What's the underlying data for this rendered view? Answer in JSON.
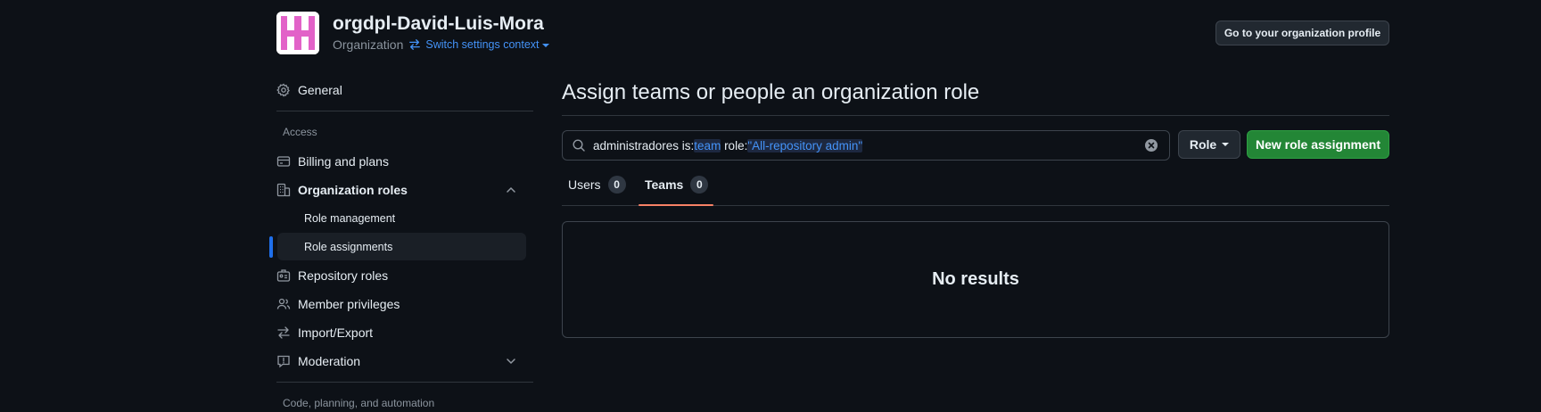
{
  "header": {
    "org_name": "orgdpl-David-Luis-Mora",
    "org_type": "Organization",
    "switch_context": "Switch settings context",
    "profile_button": "Go to your organization profile"
  },
  "sidebar": {
    "general": "General",
    "access_section": "Access",
    "billing": "Billing and plans",
    "org_roles": "Organization roles",
    "role_management": "Role management",
    "role_assignments": "Role assignments",
    "repo_roles": "Repository roles",
    "member_privileges": "Member privileges",
    "import_export": "Import/Export",
    "moderation": "Moderation",
    "code_section": "Code, planning, and automation"
  },
  "main": {
    "title": "Assign teams or people an organization role",
    "search": {
      "prefix": "administradores is:",
      "team_token": "team",
      "role_label": " role:",
      "role_value": "\"All-repository admin\""
    },
    "role_button": "Role",
    "new_button": "New role assignment",
    "tabs": [
      {
        "label": "Users",
        "count": "0"
      },
      {
        "label": "Teams",
        "count": "0"
      }
    ],
    "empty_message": "No results"
  },
  "colors": {
    "background": "#0d1117",
    "accent_blue": "#4493f8",
    "primary_green": "#238636",
    "tab_underline": "#f78166",
    "avatar_pink": "#e262c8"
  }
}
